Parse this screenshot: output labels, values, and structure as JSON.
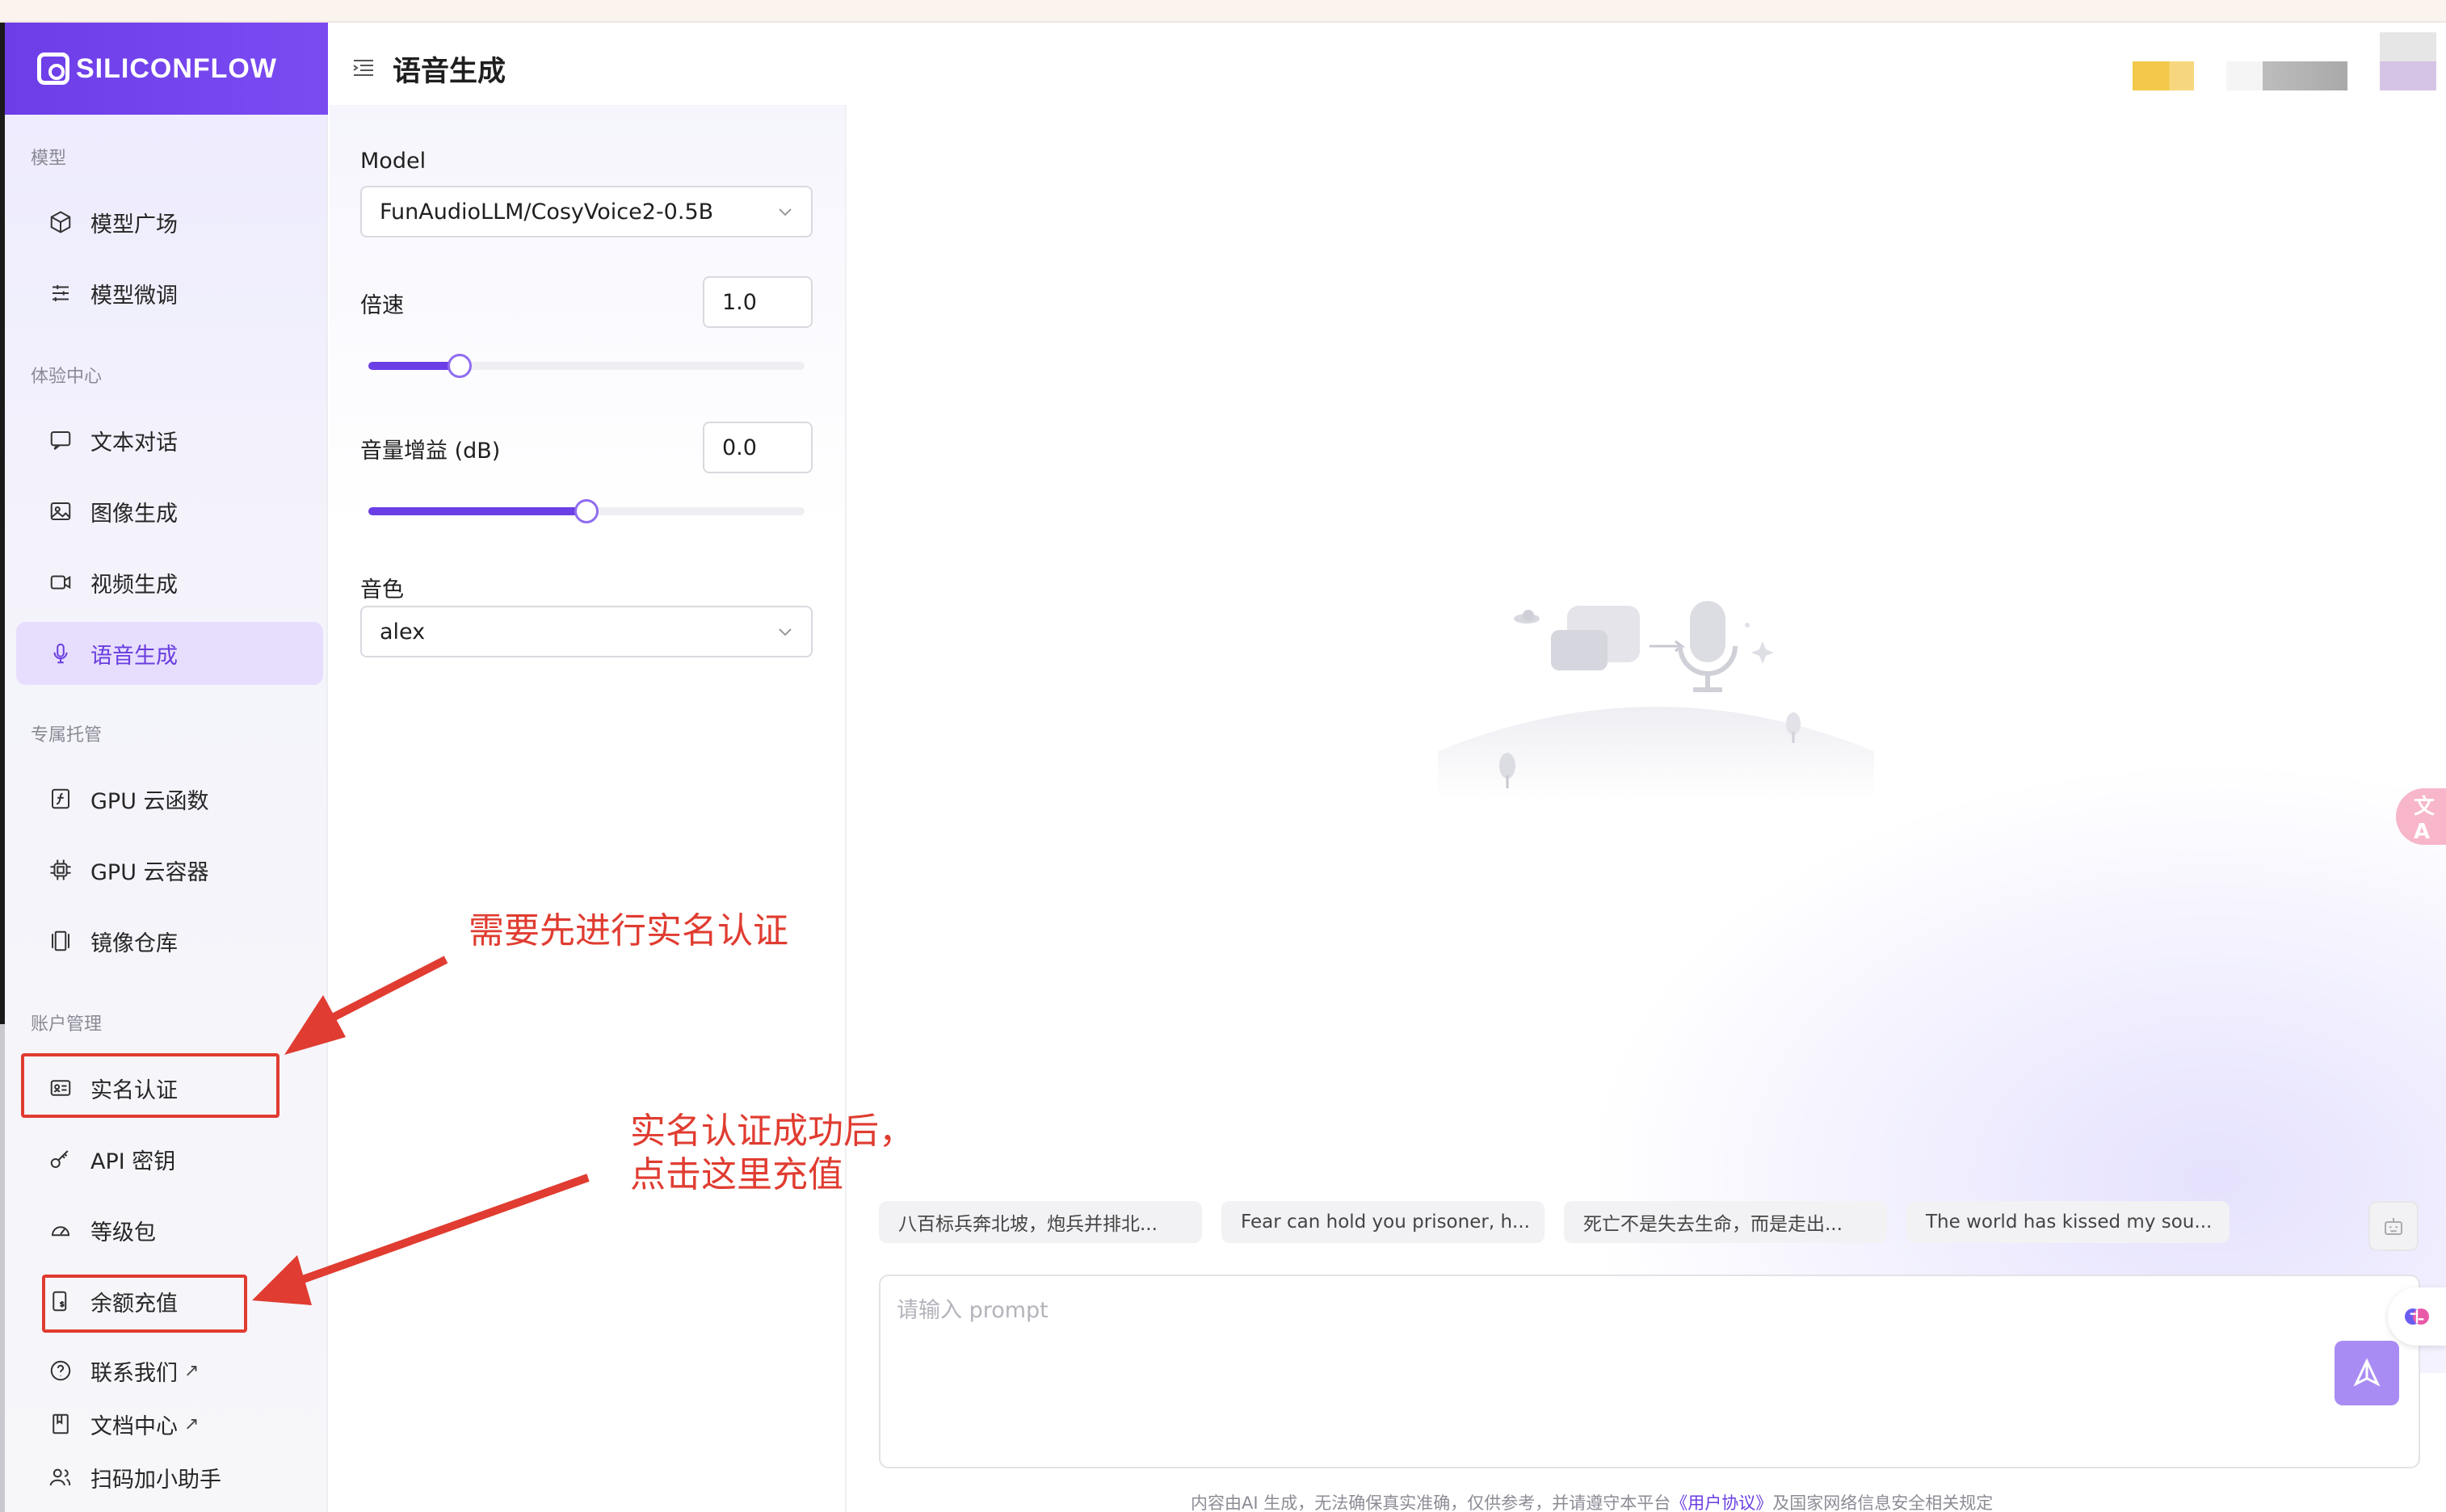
{
  "brand": {
    "name": "SILICONFLOW"
  },
  "header": {
    "title": "语音生成"
  },
  "sidebar": {
    "sections": [
      {
        "label": "模型",
        "items": [
          "模型广场",
          "模型微调"
        ]
      },
      {
        "label": "体验中心",
        "items": [
          "文本对话",
          "图像生成",
          "视频生成",
          "语音生成"
        ]
      },
      {
        "label": "专属托管",
        "items": [
          "GPU 云函数",
          "GPU 云容器",
          "镜像仓库"
        ]
      },
      {
        "label": "账户管理",
        "items": [
          "实名认证",
          "API 密钥",
          "等级包",
          "余额充值"
        ]
      }
    ],
    "links": [
      "联系我们",
      "文档中心",
      "扫码加小助手"
    ],
    "ext_arrow": "↗",
    "active": "语音生成"
  },
  "settings": {
    "model_label": "Model",
    "model_value": "FunAudioLLM/CosyVoice2-0.5B",
    "speed_label": "倍速",
    "speed_value": "1.0",
    "speed_fraction": 0.21,
    "gain_label": "音量增益 (dB)",
    "gain_value": "0.0",
    "gain_fraction": 0.5,
    "voice_label": "音色",
    "voice_value": "alex"
  },
  "suggestions": [
    "八百标兵奔北坡，炮兵并排北...",
    "Fear can hold you prisoner, h...",
    "死亡不是失去生命，而是走出...",
    "The world has kissed my sou..."
  ],
  "prompt": {
    "placeholder": "请输入 prompt",
    "value": ""
  },
  "footer": {
    "before": "内容由AI 生成，无法确保真实准确，仅供参考，并请遵守本平台",
    "link": "《用户协议》",
    "after": "及国家网络信息安全相关规定"
  },
  "float_badge": "文A",
  "annotations": {
    "note1": "需要先进行实名认证",
    "note2_line1": "实名认证成功后，",
    "note2_line2": "点击这里充值"
  },
  "colors": {
    "accent": "#6a3de0",
    "annotation": "#e03c31",
    "active_bg": "#e7defd"
  }
}
